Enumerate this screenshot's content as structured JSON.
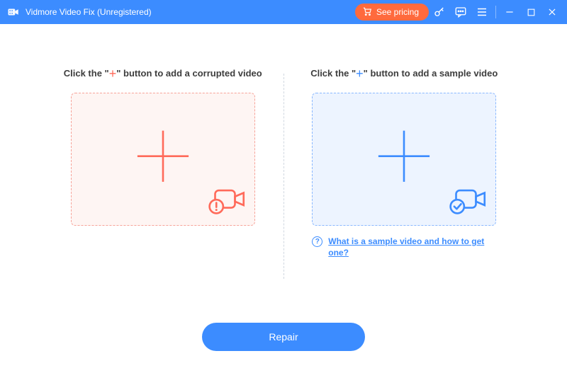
{
  "titlebar": {
    "app_title": "Vidmore Video Fix (Unregistered)",
    "see_pricing_label": "See pricing"
  },
  "left_panel": {
    "instruction_pre": "Click the \"",
    "instruction_plus": "+",
    "instruction_post": "\" button to add a corrupted video"
  },
  "right_panel": {
    "instruction_pre": "Click the \"",
    "instruction_plus": "+",
    "instruction_post": "\" button to add a sample video",
    "help_link": "What is a sample video and how to get one?"
  },
  "footer": {
    "repair_label": "Repair"
  },
  "colors": {
    "accent_blue": "#3c8cff",
    "accent_orange": "#ff6a3d",
    "danger_red": "#ff6a5a"
  }
}
